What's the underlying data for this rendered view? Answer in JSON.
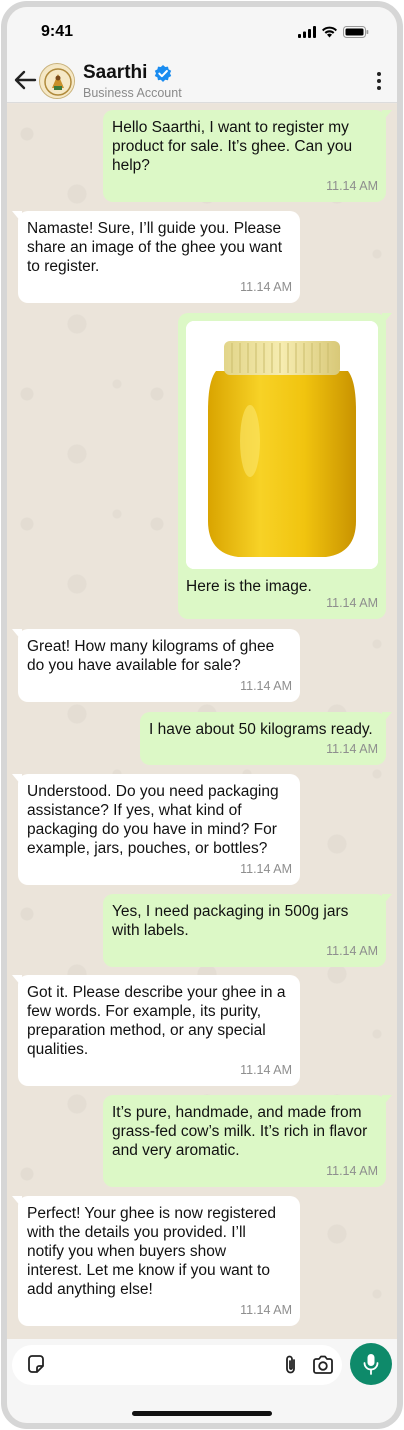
{
  "status_bar": {
    "time": "9:41",
    "icons": [
      "cellular-icon",
      "wifi-icon",
      "battery-icon"
    ]
  },
  "header": {
    "contact_name": "Saarthi",
    "subtitle": "Business Account",
    "icons": [
      "back-arrow-icon",
      "verified-badge-icon",
      "more-vertical-icon"
    ],
    "verified_color": "#1a8cf0"
  },
  "messages": [
    {
      "direction": "outgoing",
      "text": "Hello Saarthi, I want to register my\nproduct for sale. It’s ghee. Can you\nhelp?",
      "time": "11.14 AM"
    },
    {
      "direction": "incoming",
      "text": "Namaste! Sure, I’ll guide you. Please\nshare an image of the ghee you want\nto register.",
      "time": "11.14 AM"
    },
    {
      "direction": "outgoing",
      "image": "ghee-jar-photo",
      "text": "Here is the image.",
      "time": "11.14 AM"
    },
    {
      "direction": "incoming",
      "text": "Great! How many kilograms of ghee\ndo you have available for sale?",
      "time": "11.14 AM"
    },
    {
      "direction": "outgoing",
      "text": "I have about 50 kilograms ready.",
      "time": "11.14 AM"
    },
    {
      "direction": "incoming",
      "text": "Understood. Do you need packaging\nassistance? If yes, what kind of\npackaging do you have in mind? For\nexample, jars, pouches, or bottles?",
      "time": "11.14 AM"
    },
    {
      "direction": "outgoing",
      "text": "Yes, I need packaging in 500g jars\nwith labels.",
      "time": "11.14 AM"
    },
    {
      "direction": "incoming",
      "text": "Got it. Please describe your ghee in a\nfew words. For example, its purity,\npreparation method, or any special\nqualities.",
      "time": "11.14 AM"
    },
    {
      "direction": "outgoing",
      "text": "It’s pure, handmade, and made from\ngrass-fed cow’s milk. It’s rich in flavor\nand very aromatic.",
      "time": "11.14 AM"
    },
    {
      "direction": "incoming",
      "text": "Perfect! Your ghee is now registered\nwith the details you provided. I’ll\nnotify you when buyers show\ninterest. Let me know if you want to\nadd anything else!",
      "time": "11.14 AM"
    }
  ],
  "composer": {
    "value": "",
    "icons": [
      "sticker-icon",
      "attachment-icon",
      "camera-icon",
      "microphone-icon"
    ],
    "mic_color": "#0e8a6a"
  },
  "colors": {
    "outgoing_bubble": "#dcf8c6",
    "incoming_bubble": "#ffffff",
    "chat_background": "#ebe4da"
  }
}
